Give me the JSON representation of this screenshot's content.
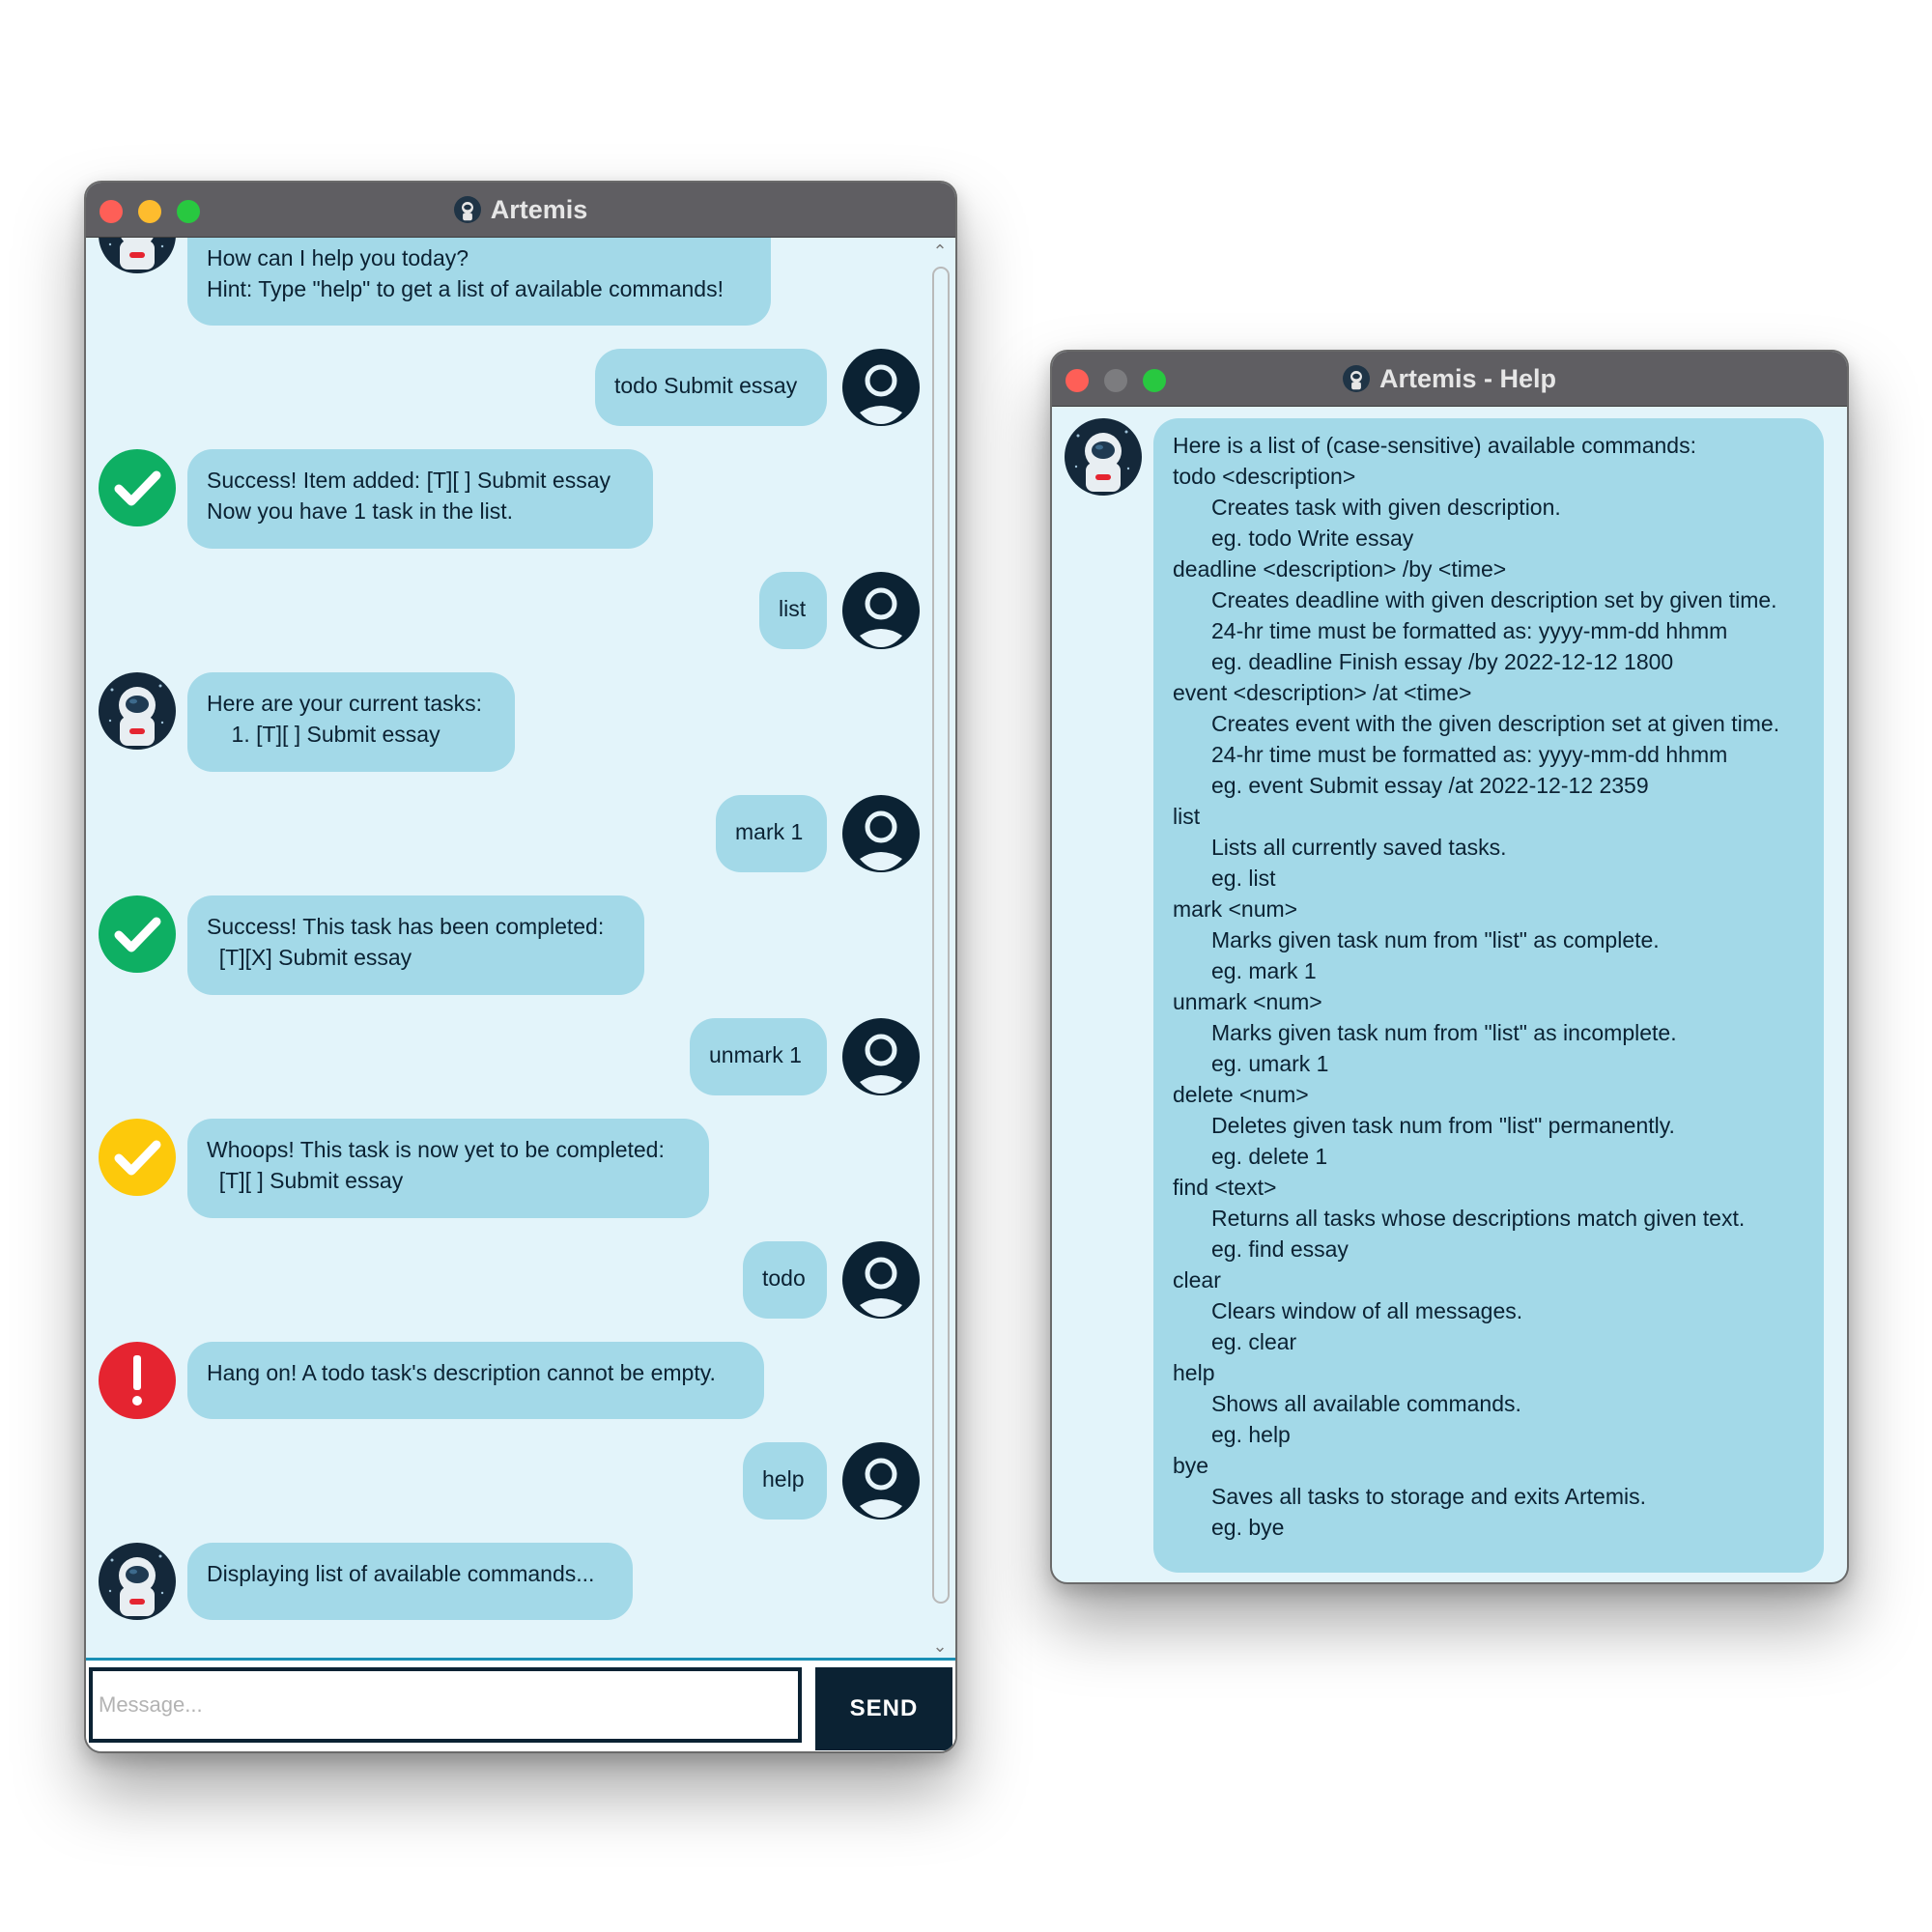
{
  "main_window": {
    "title": "Artemis",
    "messages": [
      {
        "sender": "bot",
        "icon": "astronaut-icon",
        "text": "Welcome to Artemis!\nHow can I help you today?\nHint: Type \"help\" to get a list of available commands!"
      },
      {
        "sender": "user",
        "text": "todo Submit essay"
      },
      {
        "sender": "bot",
        "icon": "success-check-icon",
        "text": "Success! Item added: [T][ ] Submit essay\nNow you have 1 task in the list."
      },
      {
        "sender": "user",
        "text": "list"
      },
      {
        "sender": "bot",
        "icon": "astronaut-icon",
        "text": "Here are your current tasks:\n    1. [T][ ] Submit essay"
      },
      {
        "sender": "user",
        "text": "mark 1"
      },
      {
        "sender": "bot",
        "icon": "success-check-icon",
        "text": "Success! This task has been completed:\n  [T][X] Submit essay"
      },
      {
        "sender": "user",
        "text": "unmark 1"
      },
      {
        "sender": "bot",
        "icon": "warning-check-icon",
        "text": "Whoops! This task is now yet to be completed:\n  [T][ ] Submit essay"
      },
      {
        "sender": "user",
        "text": "todo"
      },
      {
        "sender": "bot",
        "icon": "error-exclamation-icon",
        "text": "Hang on! A todo task's description cannot be empty."
      },
      {
        "sender": "user",
        "text": "help"
      },
      {
        "sender": "bot",
        "icon": "astronaut-icon",
        "text": "Displaying list of available commands..."
      }
    ],
    "input": {
      "placeholder": "Message...",
      "value": ""
    },
    "send_label": "SEND"
  },
  "help_window": {
    "title": "Artemis - Help",
    "lines": [
      {
        "indent": false,
        "text": "Here is a list of (case-sensitive) available commands:"
      },
      {
        "indent": false,
        "text": "todo <description>"
      },
      {
        "indent": true,
        "text": "Creates task with given description."
      },
      {
        "indent": true,
        "text": "eg. todo Write essay"
      },
      {
        "indent": false,
        "text": "deadline <description> /by <time>"
      },
      {
        "indent": true,
        "text": "Creates deadline with given description set by given time."
      },
      {
        "indent": true,
        "text": "24-hr time must be formatted as: yyyy-mm-dd hhmm"
      },
      {
        "indent": true,
        "text": "eg. deadline Finish essay /by 2022-12-12 1800"
      },
      {
        "indent": false,
        "text": "event <description> /at <time>"
      },
      {
        "indent": true,
        "text": "Creates event with the given description set at given time."
      },
      {
        "indent": true,
        "text": "24-hr time must be formatted as: yyyy-mm-dd hhmm"
      },
      {
        "indent": true,
        "text": "eg. event Submit essay /at 2022-12-12 2359"
      },
      {
        "indent": false,
        "text": "list"
      },
      {
        "indent": true,
        "text": "Lists all currently saved tasks."
      },
      {
        "indent": true,
        "text": "eg. list"
      },
      {
        "indent": false,
        "text": "mark <num>"
      },
      {
        "indent": true,
        "text": "Marks given task num from \"list\" as complete."
      },
      {
        "indent": true,
        "text": "eg. mark 1"
      },
      {
        "indent": false,
        "text": "unmark <num>"
      },
      {
        "indent": true,
        "text": "Marks given task num from \"list\" as incomplete."
      },
      {
        "indent": true,
        "text": "eg. umark 1"
      },
      {
        "indent": false,
        "text": "delete <num>"
      },
      {
        "indent": true,
        "text": "Deletes given task num from \"list\" permanently."
      },
      {
        "indent": true,
        "text": "eg. delete 1"
      },
      {
        "indent": false,
        "text": "find <text>"
      },
      {
        "indent": true,
        "text": "Returns all tasks whose descriptions match given text."
      },
      {
        "indent": true,
        "text": "eg. find essay"
      },
      {
        "indent": false,
        "text": "clear"
      },
      {
        "indent": true,
        "text": "Clears window of all messages."
      },
      {
        "indent": true,
        "text": "eg. clear"
      },
      {
        "indent": false,
        "text": "help"
      },
      {
        "indent": true,
        "text": "Shows all available commands."
      },
      {
        "indent": true,
        "text": "eg. help"
      },
      {
        "indent": false,
        "text": "bye"
      },
      {
        "indent": true,
        "text": "Saves all tasks to storage and exits Artemis."
      },
      {
        "indent": true,
        "text": "eg. bye"
      }
    ]
  },
  "colors": {
    "window_bg": "#e3f4fa",
    "bubble": "#a3d9e8",
    "navy": "#0b2233",
    "success": "#0eaf63",
    "warning": "#fdc90b",
    "error": "#e52430",
    "titlebar": "#5f5e62"
  }
}
